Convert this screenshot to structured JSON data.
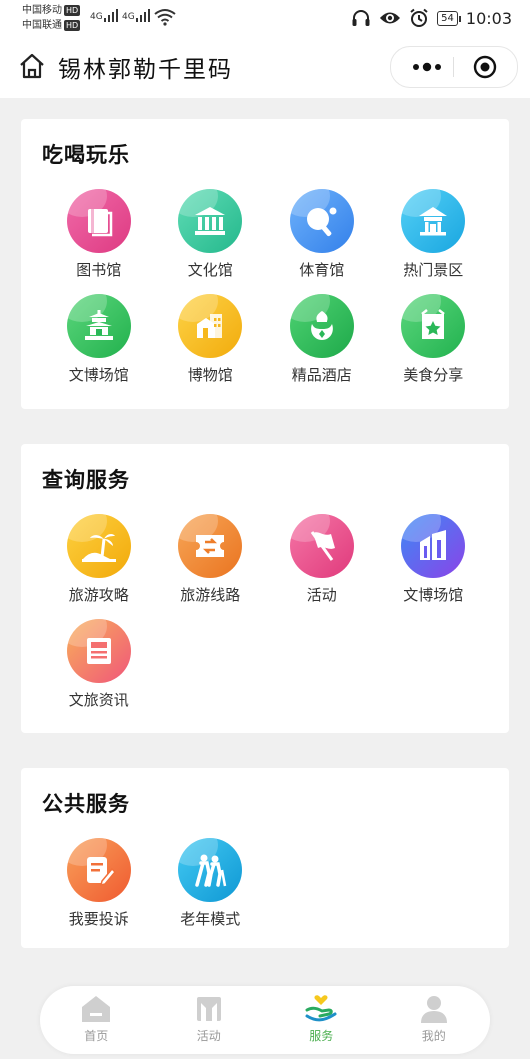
{
  "status_bar": {
    "carrier1": "中国移动",
    "carrier2": "中国联通",
    "hd_badge": "HD",
    "net_type": "4G",
    "battery": "54",
    "time": "10:03"
  },
  "nav": {
    "title": "锡林郭勒千里码"
  },
  "sections": [
    {
      "title": "吃喝玩乐",
      "items": [
        {
          "label": "图书馆",
          "icon": "book-icon",
          "color": "#e7478f"
        },
        {
          "label": "文化馆",
          "icon": "museum-building-icon",
          "color": "#32c69c"
        },
        {
          "label": "体育馆",
          "icon": "ping-pong-icon",
          "color": "#3d8ef0"
        },
        {
          "label": "热门景区",
          "icon": "pavilion-icon",
          "color": "#25b5ea"
        },
        {
          "label": "文博场馆",
          "icon": "temple-icon",
          "color": "#2dbd5c"
        },
        {
          "label": "博物馆",
          "icon": "buildings-icon",
          "color": "#f7b81b"
        },
        {
          "label": "精品酒店",
          "icon": "hotel-icon",
          "color": "#2ab85a"
        },
        {
          "label": "美食分享",
          "icon": "food-bag-icon",
          "color": "#2ec05c"
        }
      ]
    },
    {
      "title": "查询服务",
      "items": [
        {
          "label": "旅游攻略",
          "icon": "beach-icon",
          "color": "#f6b512"
        },
        {
          "label": "旅游线路",
          "icon": "ticket-icon",
          "color": "#f0842c"
        },
        {
          "label": "活动",
          "icon": "flag-icon",
          "color": "#ec4a86"
        },
        {
          "label": "文博场馆",
          "icon": "city-building-icon",
          "color": "#7b4ff0"
        },
        {
          "label": "文旅资讯",
          "icon": "newspaper-icon",
          "color": "#f46a6a"
        }
      ]
    },
    {
      "title": "公共服务",
      "items": [
        {
          "label": "我要投诉",
          "icon": "complaint-edit-icon",
          "color": "#f36a3a"
        },
        {
          "label": "老年模式",
          "icon": "elderly-icon",
          "color": "#1eaee0"
        }
      ]
    }
  ],
  "tabbar": {
    "items": [
      {
        "label": "首页",
        "icon": "home-tab-icon"
      },
      {
        "label": "活动",
        "icon": "activity-tab-icon"
      },
      {
        "label": "服务",
        "icon": "service-tab-icon"
      },
      {
        "label": "我的",
        "icon": "profile-tab-icon"
      }
    ],
    "active": "服务",
    "active_color": "#4caf50"
  }
}
